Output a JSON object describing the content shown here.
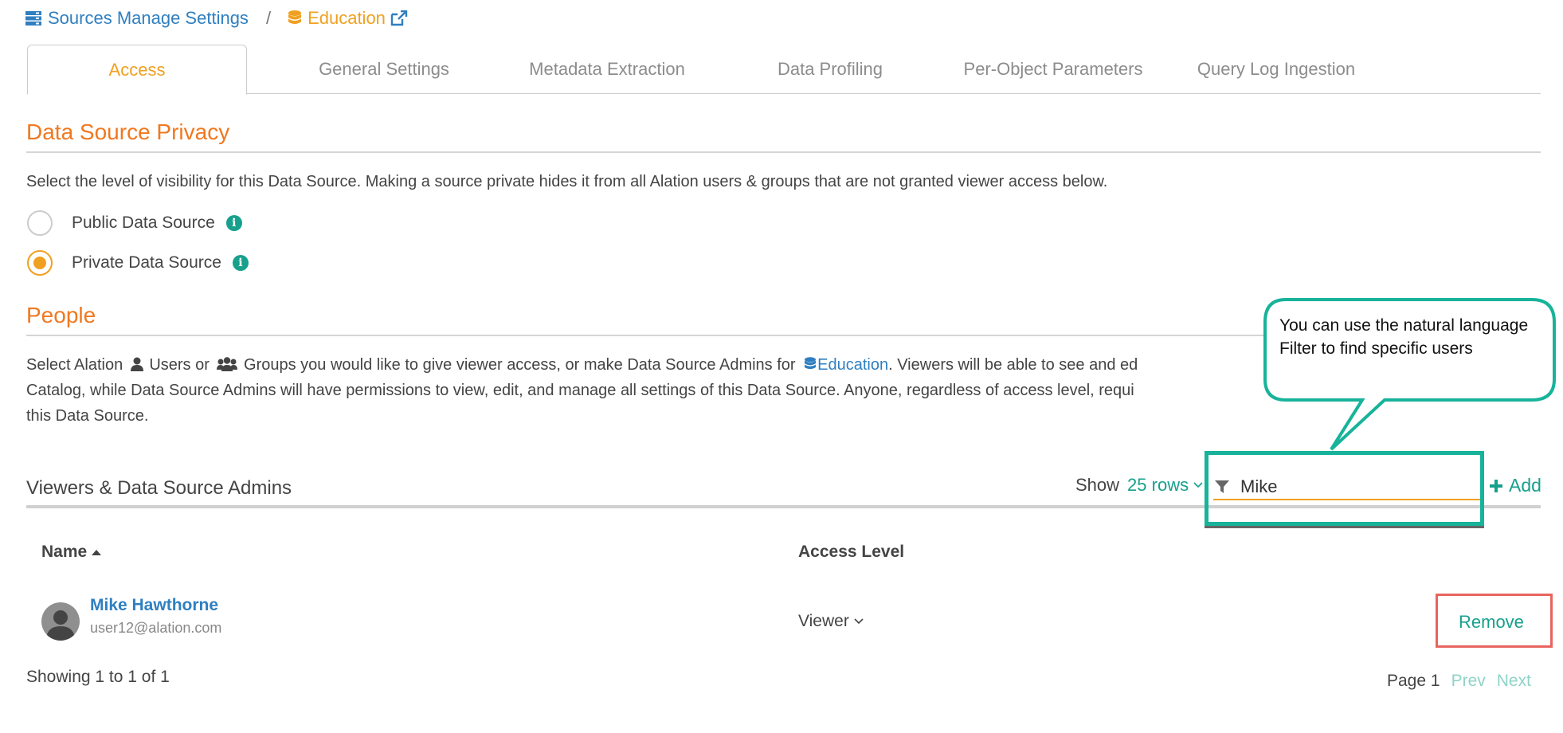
{
  "breadcrumb": {
    "root": "Sources Manage Settings",
    "separator": "/",
    "source": "Education"
  },
  "tabs": [
    {
      "label": "Access"
    },
    {
      "label": "General Settings"
    },
    {
      "label": "Metadata Extraction"
    },
    {
      "label": "Data Profiling"
    },
    {
      "label": "Per-Object Parameters"
    },
    {
      "label": "Query Log Ingestion"
    }
  ],
  "active_tab": "Access",
  "privacy": {
    "title": "Data Source Privacy",
    "description": "Select the level of visibility for this Data Source. Making a source private hides it from all Alation users & groups that are not granted viewer access below.",
    "options": [
      {
        "label": "Public Data Source",
        "selected": false
      },
      {
        "label": "Private Data Source",
        "selected": true
      }
    ]
  },
  "people": {
    "title": "People",
    "desc_part1": "Select Alation",
    "desc_users": "Users or",
    "desc_groups": "Groups you would like to give viewer access, or make Data Source Admins for",
    "desc_source": "Education",
    "desc_part2": ". Viewers will be able to see and ed",
    "desc_line2": "Catalog, while Data Source Admins will have permissions to view, edit, and manage all settings of this Data Source. Anyone, regardless of access level, requi",
    "desc_line3": "this Data Source."
  },
  "viewers": {
    "title": "Viewers & Data Source Admins",
    "show_label": "Show",
    "rows_label": "25 rows",
    "filter_value": "Mike",
    "add_label": "Add"
  },
  "table": {
    "columns": [
      "Name",
      "Access Level"
    ],
    "rows": [
      {
        "name": "Mike Hawthorne",
        "email": "user12@alation.com",
        "access": "Viewer",
        "action": "Remove"
      }
    ]
  },
  "footer": {
    "showing": "Showing 1 to 1 of 1",
    "page": "Page 1",
    "prev": "Prev",
    "next": "Next"
  },
  "callout": {
    "text": "You can use the natural language Filter to find specific users"
  },
  "colors": {
    "accent_orange": "#f07820",
    "accent_yellow": "#f0a020",
    "link_blue": "#2f7fc0",
    "teal": "#17a08c",
    "highlight_teal": "#17b39a",
    "highlight_red": "#e8645e"
  }
}
